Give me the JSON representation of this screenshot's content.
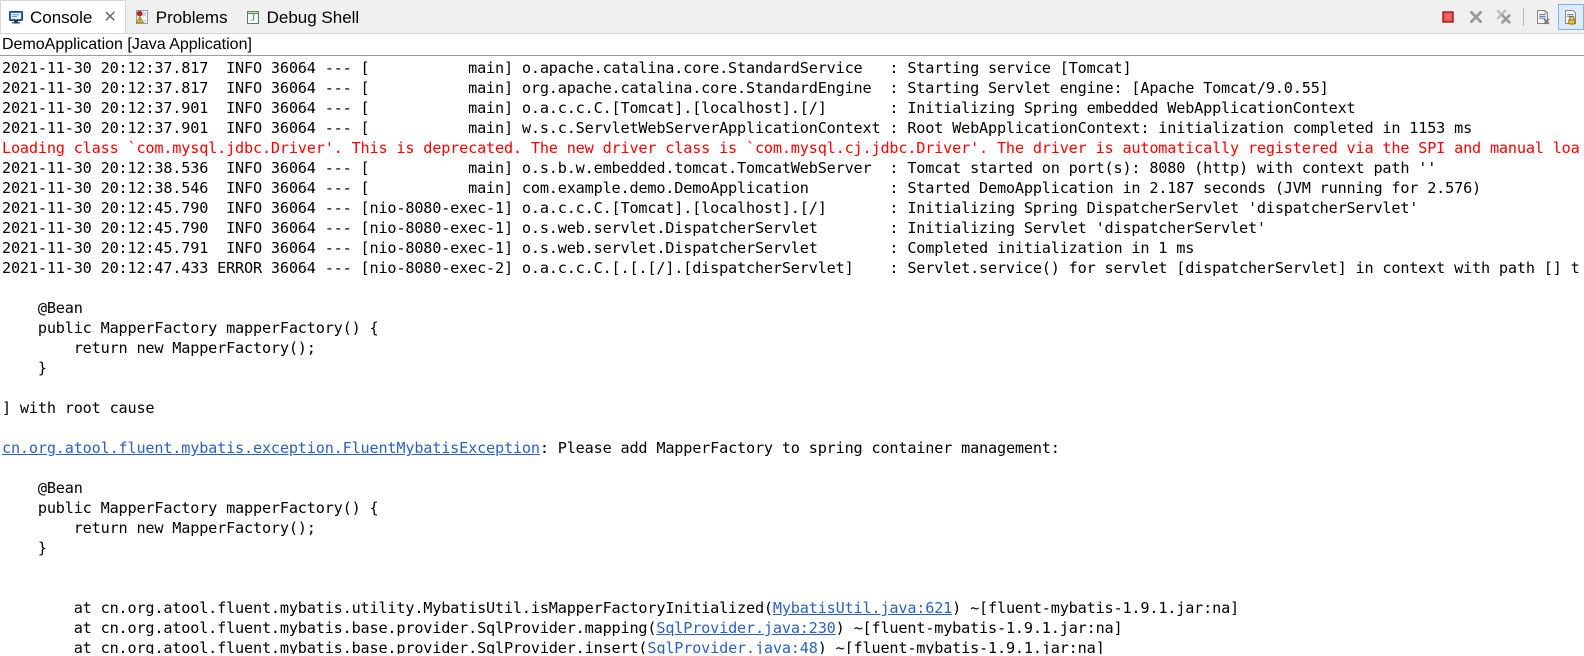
{
  "window": {
    "title": "Console"
  },
  "tabs": [
    {
      "label": "Console",
      "icon": "console-monitor-icon",
      "active": true,
      "closable": true,
      "close_glyph": "✕"
    },
    {
      "label": "Problems",
      "icon": "problems-icon",
      "active": false,
      "closable": false
    },
    {
      "label": "Debug Shell",
      "icon": "debug-shell-icon",
      "active": false,
      "closable": false
    }
  ],
  "toolbar": {
    "buttons": [
      {
        "name": "terminate-button",
        "icon": "stop-square-icon",
        "enabled": true,
        "toggled": false
      },
      {
        "name": "remove-launch-button",
        "icon": "remove-x-icon",
        "enabled": false,
        "toggled": false
      },
      {
        "name": "remove-all-launches-button",
        "icon": "remove-all-x-icon",
        "enabled": false,
        "toggled": false
      },
      {
        "name": "separator",
        "icon": "separator",
        "enabled": false,
        "toggled": false
      },
      {
        "name": "clear-console-button",
        "icon": "clear-console-icon",
        "enabled": true,
        "toggled": false
      },
      {
        "name": "scroll-lock-button",
        "icon": "scroll-lock-icon",
        "enabled": true,
        "toggled": true
      }
    ]
  },
  "launch": {
    "title": "DemoApplication [Java Application]"
  },
  "console": {
    "lines": [
      {
        "kind": "plain",
        "color": "black",
        "text": "2021-11-30 20:12:37.817  INFO 36064 --- [           main] o.apache.catalina.core.StandardService   : Starting service [Tomcat]"
      },
      {
        "kind": "plain",
        "color": "black",
        "text": "2021-11-30 20:12:37.817  INFO 36064 --- [           main] org.apache.catalina.core.StandardEngine  : Starting Servlet engine: [Apache Tomcat/9.0.55]"
      },
      {
        "kind": "plain",
        "color": "black",
        "text": "2021-11-30 20:12:37.901  INFO 36064 --- [           main] o.a.c.c.C.[Tomcat].[localhost].[/]       : Initializing Spring embedded WebApplicationContext"
      },
      {
        "kind": "plain",
        "color": "black",
        "text": "2021-11-30 20:12:37.901  INFO 36064 --- [           main] w.s.c.ServletWebServerApplicationContext : Root WebApplicationContext: initialization completed in 1153 ms"
      },
      {
        "kind": "plain",
        "color": "red",
        "text": "Loading class `com.mysql.jdbc.Driver'. This is deprecated. The new driver class is `com.mysql.cj.jdbc.Driver'. The driver is automatically registered via the SPI and manual loa"
      },
      {
        "kind": "plain",
        "color": "black",
        "text": "2021-11-30 20:12:38.536  INFO 36064 --- [           main] o.s.b.w.embedded.tomcat.TomcatWebServer  : Tomcat started on port(s): 8080 (http) with context path ''"
      },
      {
        "kind": "plain",
        "color": "black",
        "text": "2021-11-30 20:12:38.546  INFO 36064 --- [           main] com.example.demo.DemoApplication         : Started DemoApplication in 2.187 seconds (JVM running for 2.576)"
      },
      {
        "kind": "plain",
        "color": "black",
        "text": "2021-11-30 20:12:45.790  INFO 36064 --- [nio-8080-exec-1] o.a.c.c.C.[Tomcat].[localhost].[/]       : Initializing Spring DispatcherServlet 'dispatcherServlet'"
      },
      {
        "kind": "plain",
        "color": "black",
        "text": "2021-11-30 20:12:45.790  INFO 36064 --- [nio-8080-exec-1] o.s.web.servlet.DispatcherServlet        : Initializing Servlet 'dispatcherServlet'"
      },
      {
        "kind": "plain",
        "color": "black",
        "text": "2021-11-30 20:12:45.791  INFO 36064 --- [nio-8080-exec-1] o.s.web.servlet.DispatcherServlet        : Completed initialization in 1 ms"
      },
      {
        "kind": "plain",
        "color": "black",
        "text": "2021-11-30 20:12:47.433 ERROR 36064 --- [nio-8080-exec-2] o.a.c.c.C.[.[.[/].[dispatcherServlet]    : Servlet.service() for servlet [dispatcherServlet] in context with path [] t"
      },
      {
        "kind": "blank",
        "color": "black",
        "text": ""
      },
      {
        "kind": "plain",
        "color": "black",
        "text": "    @Bean"
      },
      {
        "kind": "plain",
        "color": "black",
        "text": "    public MapperFactory mapperFactory() {"
      },
      {
        "kind": "plain",
        "color": "black",
        "text": "        return new MapperFactory();"
      },
      {
        "kind": "plain",
        "color": "black",
        "text": "    }"
      },
      {
        "kind": "blank",
        "color": "black",
        "text": ""
      },
      {
        "kind": "plain",
        "color": "black",
        "text": "] with root cause"
      },
      {
        "kind": "blank",
        "color": "black",
        "text": ""
      },
      {
        "kind": "link-prefix",
        "color": "black",
        "link_text": "cn.org.atool.fluent.mybatis.exception.FluentMybatisException",
        "text": ": Please add MapperFactory to spring container management:"
      },
      {
        "kind": "blank",
        "color": "black",
        "text": ""
      },
      {
        "kind": "plain",
        "color": "black",
        "text": "    @Bean"
      },
      {
        "kind": "plain",
        "color": "black",
        "text": "    public MapperFactory mapperFactory() {"
      },
      {
        "kind": "plain",
        "color": "black",
        "text": "        return new MapperFactory();"
      },
      {
        "kind": "plain",
        "color": "black",
        "text": "    }"
      },
      {
        "kind": "blank",
        "color": "black",
        "text": ""
      },
      {
        "kind": "blank",
        "color": "black",
        "text": ""
      },
      {
        "kind": "link-middle",
        "color": "black",
        "prefix": "        at cn.org.atool.fluent.mybatis.utility.MybatisUtil.isMapperFactoryInitialized(",
        "link_text": "MybatisUtil.java:621",
        "suffix": ") ~[fluent-mybatis-1.9.1.jar:na]"
      },
      {
        "kind": "link-middle",
        "color": "black",
        "prefix": "        at cn.org.atool.fluent.mybatis.base.provider.SqlProvider.mapping(",
        "link_text": "SqlProvider.java:230",
        "suffix": ") ~[fluent-mybatis-1.9.1.jar:na]"
      },
      {
        "kind": "link-middle",
        "color": "black",
        "prefix": "        at cn.org.atool.fluent.mybatis.base.provider.SqlProvider.insert(",
        "link_text": "SqlProvider.java:48",
        "suffix": ") ~[fluent-mybatis-1.9.1.jar:na]"
      }
    ]
  },
  "colors": {
    "error_text": "#ff0000",
    "hyperlink": "#2a62c4",
    "plain_text": "#000000",
    "tab_bar_background": "#f0f0f0",
    "console_background": "#ffffff",
    "stop_button": "#e03a3a",
    "toggled_button": "#dcebfb"
  }
}
